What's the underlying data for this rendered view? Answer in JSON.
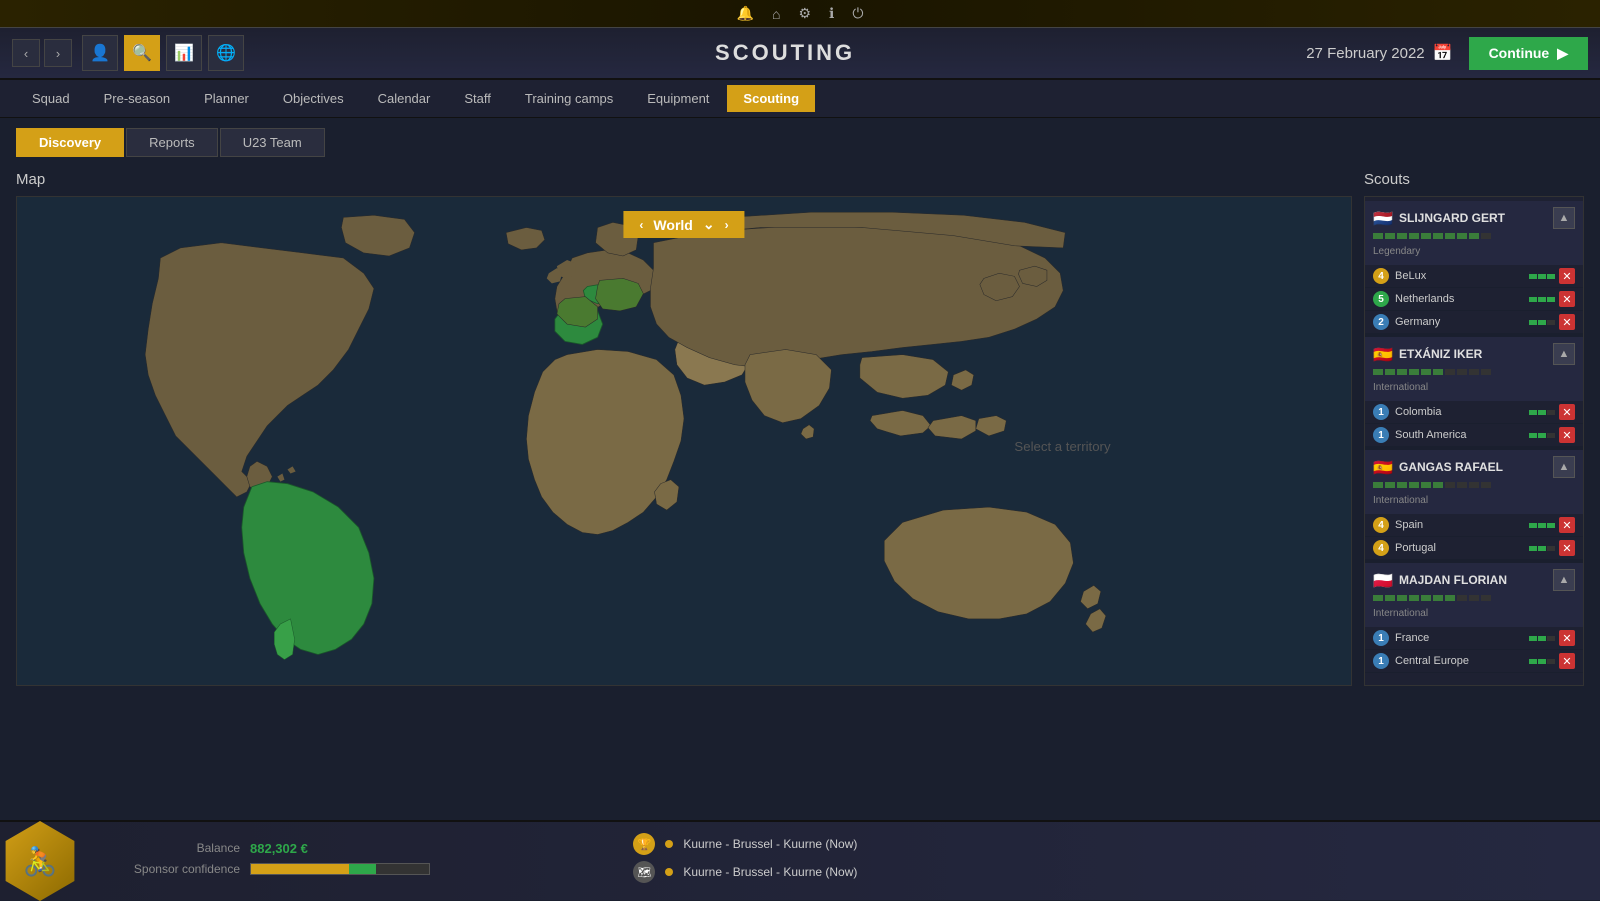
{
  "topbar": {
    "icons": [
      "bell",
      "home",
      "gear",
      "info",
      "power"
    ]
  },
  "titlebar": {
    "title": "SCOUTING",
    "date": "27 February 2022",
    "continue_label": "Continue"
  },
  "nav_tabs": [
    {
      "id": "squad",
      "label": "Squad"
    },
    {
      "id": "preseason",
      "label": "Pre-season"
    },
    {
      "id": "planner",
      "label": "Planner"
    },
    {
      "id": "objectives",
      "label": "Objectives"
    },
    {
      "id": "calendar",
      "label": "Calendar"
    },
    {
      "id": "staff",
      "label": "Staff"
    },
    {
      "id": "training_camps",
      "label": "Training camps"
    },
    {
      "id": "equipment",
      "label": "Equipment"
    },
    {
      "id": "scouting",
      "label": "Scouting",
      "active": true
    }
  ],
  "sub_tabs": [
    {
      "id": "discovery",
      "label": "Discovery",
      "active": true
    },
    {
      "id": "reports",
      "label": "Reports"
    },
    {
      "id": "u23team",
      "label": "U23 Team"
    }
  ],
  "map_section": {
    "title": "Map",
    "selector_label": "World",
    "select_territory_text": "Select a territory"
  },
  "scouts_section": {
    "title": "Scouts",
    "scouts": [
      {
        "id": "slijngard_gert",
        "name": "SLIJNGARD GERT",
        "flag": "🇳🇱",
        "rank_label": "Legendary",
        "rank_filled": 9,
        "rank_total": 10,
        "assignments": [
          {
            "num": 4,
            "num_class": "num-4",
            "name": "BeLux",
            "bar_filled": 3,
            "bar_total": 3
          },
          {
            "num": 5,
            "num_class": "num-5",
            "name": "Netherlands",
            "bar_filled": 3,
            "bar_total": 3
          },
          {
            "num": 2,
            "num_class": "num-2",
            "name": "Germany",
            "bar_filled": 2,
            "bar_total": 3
          }
        ]
      },
      {
        "id": "etxaniz_iker",
        "name": "ETXÁNIZ IKER",
        "flag": "🇪🇸",
        "rank_label": "International",
        "rank_filled": 6,
        "rank_total": 10,
        "assignments": [
          {
            "num": 1,
            "num_class": "num-1",
            "name": "Colombia",
            "bar_filled": 2,
            "bar_total": 3
          },
          {
            "num": 1,
            "num_class": "num-1",
            "name": "South America",
            "bar_filled": 2,
            "bar_total": 3
          }
        ]
      },
      {
        "id": "gangas_rafael",
        "name": "GANGAS RAFAEL",
        "flag": "🇪🇸",
        "rank_label": "International",
        "rank_filled": 6,
        "rank_total": 10,
        "assignments": [
          {
            "num": 4,
            "num_class": "num-4",
            "name": "Spain",
            "bar_filled": 3,
            "bar_total": 3
          },
          {
            "num": 4,
            "num_class": "num-4",
            "name": "Portugal",
            "bar_filled": 2,
            "bar_total": 3
          }
        ]
      },
      {
        "id": "majdan_florian",
        "name": "MAJDAN FLORIAN",
        "flag": "🇵🇱",
        "rank_label": "International",
        "rank_filled": 7,
        "rank_total": 10,
        "assignments": [
          {
            "num": 1,
            "num_class": "num-1",
            "name": "France",
            "bar_filled": 2,
            "bar_total": 3
          },
          {
            "num": 1,
            "num_class": "num-1",
            "name": "Central Europe",
            "bar_filled": 2,
            "bar_total": 3
          }
        ]
      }
    ]
  },
  "bottom": {
    "balance_label": "Balance",
    "balance_value": "882,302 €",
    "sponsor_label": "Sponsor confidence",
    "races": [
      {
        "icon": "trophy",
        "dot_color": "#d4a017",
        "text": "Kuurne - Brussel - Kuurne (Now)"
      },
      {
        "icon": "route",
        "dot_color": "#d4a017",
        "text": "Kuurne - Brussel - Kuurne (Now)"
      }
    ]
  }
}
